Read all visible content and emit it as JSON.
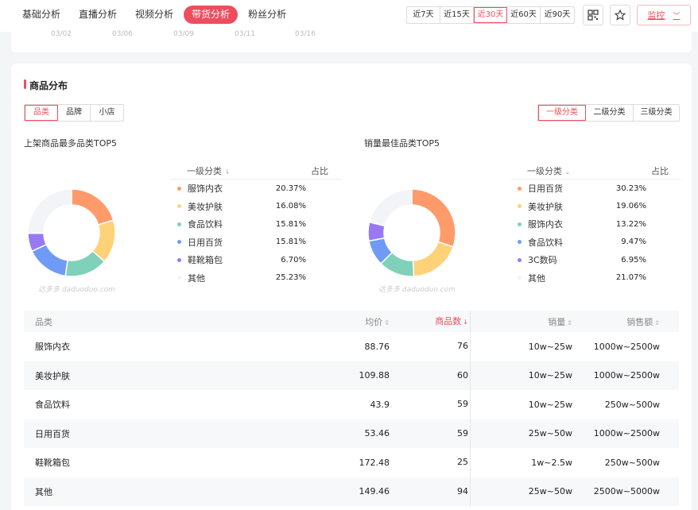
{
  "nav": {
    "tabs": [
      "基础分析",
      "直播分析",
      "视频分析",
      "带货分析",
      "粉丝分析"
    ],
    "active_tab": 3,
    "ranges": [
      "近7天",
      "近15天",
      "近30天",
      "近60天",
      "近90天"
    ],
    "active_range": 2,
    "monitor_label": "监控"
  },
  "prev_chart": {
    "ticks": [
      "03/02",
      "03/06",
      "03/09",
      "03/11",
      "03/16"
    ]
  },
  "section": {
    "title": "商品分布",
    "dim_tabs": [
      "品类",
      "品牌",
      "小店"
    ],
    "level_tabs": [
      "一级分类",
      "二级分类",
      "三级分类"
    ]
  },
  "left_panel": {
    "title": "上架商品最多品类TOP5",
    "col_category": "一级分类",
    "col_share": "占比",
    "watermark": "达多多 daduoduo.com"
  },
  "right_panel": {
    "title": "销量最佳品类TOP5",
    "col_category": "一级分类",
    "col_share": "占比",
    "watermark": "达多多 daduoduo.com"
  },
  "colors": {
    "accent": "#ee4d5e",
    "slices": [
      "#ff9b6a",
      "#ffd27a",
      "#7fd1b9",
      "#6f9bf7",
      "#9879f2",
      "#f2f4f7"
    ]
  },
  "chart_data": [
    {
      "type": "pie",
      "title": "上架商品最多品类TOP5",
      "categories": [
        "服饰内衣",
        "美妆护肤",
        "食品饮料",
        "日用百货",
        "鞋靴箱包",
        "其他"
      ],
      "values": [
        20.37,
        16.08,
        15.81,
        15.81,
        6.7,
        25.23
      ],
      "labels": [
        "20.37%",
        "16.08%",
        "15.81%",
        "15.81%",
        "6.70%",
        "25.23%"
      ]
    },
    {
      "type": "pie",
      "title": "销量最佳品类TOP5",
      "categories": [
        "日用百货",
        "美妆护肤",
        "服饰内衣",
        "食品饮料",
        "3C数码",
        "其他"
      ],
      "values": [
        30.23,
        19.06,
        13.22,
        9.47,
        6.95,
        21.07
      ],
      "labels": [
        "30.23%",
        "19.06%",
        "13.22%",
        "9.47%",
        "6.95%",
        "21.07%"
      ]
    }
  ],
  "table": {
    "headers": [
      "品类",
      "均价",
      "商品数",
      "销量",
      "销售额"
    ],
    "rows": [
      [
        "服饰内衣",
        "88.76",
        "76",
        "10w~25w",
        "1000w~2500w"
      ],
      [
        "美妆护肤",
        "109.88",
        "60",
        "10w~25w",
        "1000w~2500w"
      ],
      [
        "食品饮料",
        "43.9",
        "59",
        "10w~25w",
        "250w~500w"
      ],
      [
        "日用百货",
        "53.46",
        "59",
        "25w~50w",
        "1000w~2500w"
      ],
      [
        "鞋靴箱包",
        "172.48",
        "25",
        "1w~2.5w",
        "250w~500w"
      ],
      [
        "其他",
        "149.46",
        "94",
        "25w~50w",
        "2500w~5000w"
      ]
    ]
  }
}
